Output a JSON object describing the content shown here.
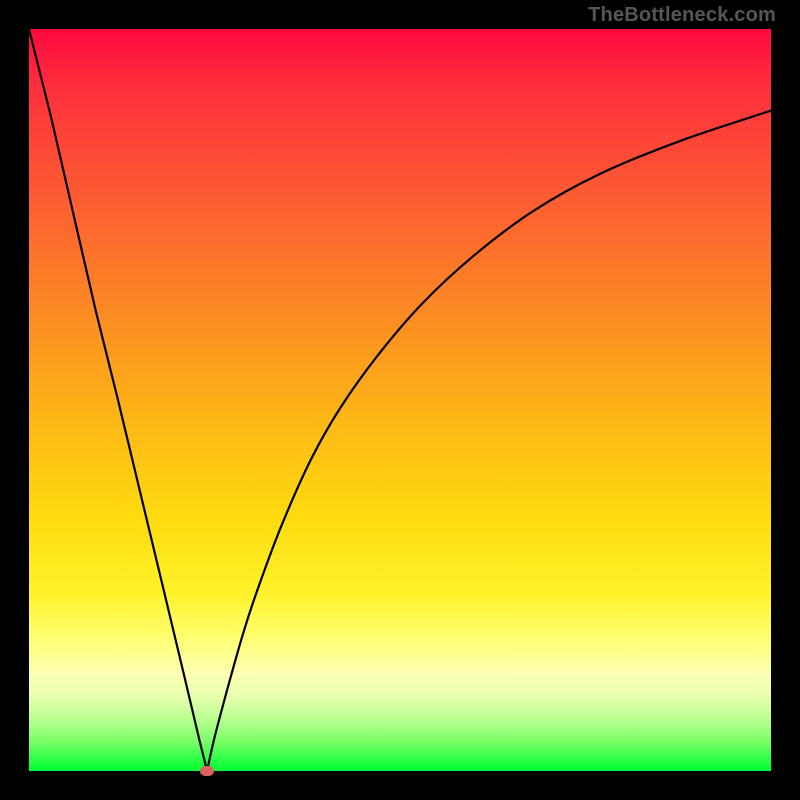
{
  "watermark": "TheBottleneck.com",
  "colors": {
    "background": "#000000",
    "curve": "#000000",
    "marker": "#d96260",
    "gradient_top": "#fe093e",
    "gradient_bottom": "#00ff33"
  },
  "chart_data": {
    "type": "line",
    "title": "",
    "xlabel": "",
    "ylabel": "",
    "xlim": [
      0,
      100
    ],
    "ylim": [
      0,
      100
    ],
    "grid": false,
    "legend": false,
    "annotations": [],
    "marker": {
      "x": 24,
      "y": 0,
      "color": "#d96260"
    },
    "series": [
      {
        "name": "bottleneck-curve",
        "x": [
          0,
          3,
          6,
          9,
          12,
          15,
          18,
          21,
          23,
          24,
          25,
          27,
          29,
          31,
          34,
          38,
          42,
          47,
          53,
          60,
          68,
          77,
          88,
          100
        ],
        "y": [
          100,
          88,
          75,
          62,
          50,
          37.5,
          25,
          12.5,
          4,
          0,
          4.5,
          12,
          19,
          25,
          33,
          42,
          49,
          56,
          63,
          69.5,
          75.5,
          80.5,
          85,
          89
        ]
      }
    ]
  }
}
